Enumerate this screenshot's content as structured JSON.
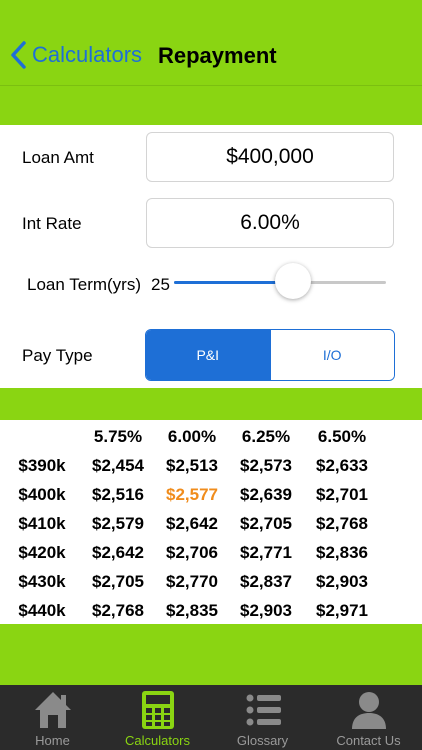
{
  "nav": {
    "back_label": "Calculators",
    "title": "Repayment"
  },
  "form": {
    "loan_amt_label": "Loan Amt",
    "loan_amt_value": "$400,000",
    "int_rate_label": "Int Rate",
    "int_rate_value": "6.00%",
    "loan_term_label": "Loan Term(yrs)",
    "loan_term_value": "25",
    "loan_term_slider_fraction": 0.56,
    "pay_type_label": "Pay Type",
    "pay_type_options": [
      "P&I",
      "I/O"
    ],
    "pay_type_selected": "P&I"
  },
  "table": {
    "rates": [
      "5.75%",
      "6.00%",
      "6.25%",
      "6.50%"
    ],
    "rows": [
      {
        "amount": "$390k",
        "values": [
          "$2,454",
          "$2,513",
          "$2,573",
          "$2,633"
        ]
      },
      {
        "amount": "$400k",
        "values": [
          "$2,516",
          "$2,577",
          "$2,639",
          "$2,701"
        ]
      },
      {
        "amount": "$410k",
        "values": [
          "$2,579",
          "$2,642",
          "$2,705",
          "$2,768"
        ]
      },
      {
        "amount": "$420k",
        "values": [
          "$2,642",
          "$2,706",
          "$2,771",
          "$2,836"
        ]
      },
      {
        "amount": "$430k",
        "values": [
          "$2,705",
          "$2,770",
          "$2,837",
          "$2,903"
        ]
      },
      {
        "amount": "$440k",
        "values": [
          "$2,768",
          "$2,835",
          "$2,903",
          "$2,971"
        ]
      }
    ],
    "highlight_color": "#f08c1c"
  },
  "tabs": [
    {
      "label": "Home",
      "icon": "home-icon"
    },
    {
      "label": "Calculators",
      "icon": "calculator-icon"
    },
    {
      "label": "Glossary",
      "icon": "list-icon"
    },
    {
      "label": "Contact Us",
      "icon": "person-icon"
    }
  ],
  "colors": {
    "brand_green": "#8ad512",
    "accent_blue": "#1e6fd6",
    "tabbar_bg": "#2b2b2b"
  }
}
